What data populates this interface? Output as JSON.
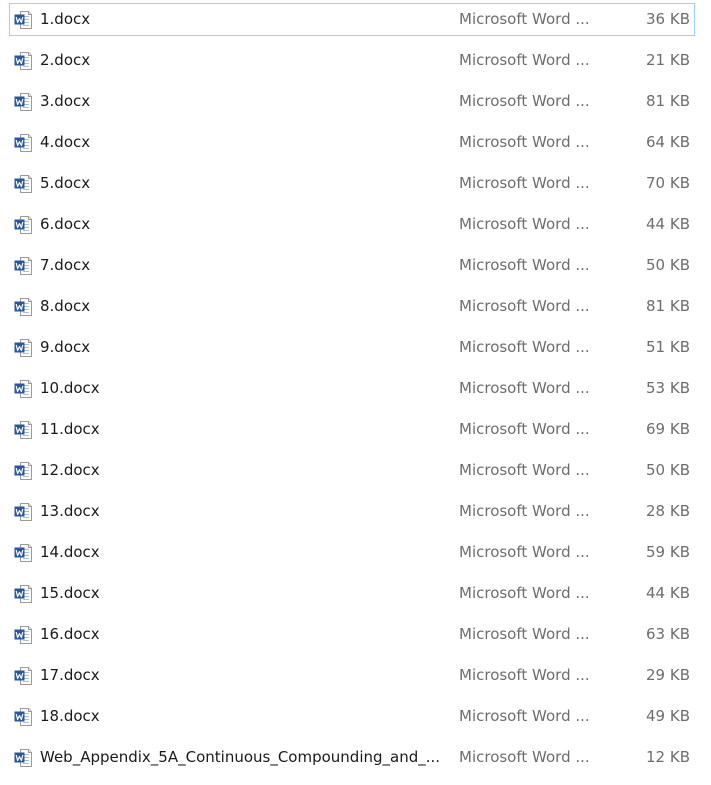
{
  "files": [
    {
      "name": "1.docx",
      "type": "Microsoft Word ...",
      "size": "36 KB",
      "icon": "word-document-icon"
    },
    {
      "name": "2.docx",
      "type": "Microsoft Word ...",
      "size": "21 KB",
      "icon": "word-document-icon"
    },
    {
      "name": "3.docx",
      "type": "Microsoft Word ...",
      "size": "81 KB",
      "icon": "word-document-icon"
    },
    {
      "name": "4.docx",
      "type": "Microsoft Word ...",
      "size": "64 KB",
      "icon": "word-document-icon"
    },
    {
      "name": "5.docx",
      "type": "Microsoft Word ...",
      "size": "70 KB",
      "icon": "word-document-icon"
    },
    {
      "name": "6.docx",
      "type": "Microsoft Word ...",
      "size": "44 KB",
      "icon": "word-document-icon"
    },
    {
      "name": "7.docx",
      "type": "Microsoft Word ...",
      "size": "50 KB",
      "icon": "word-document-icon"
    },
    {
      "name": "8.docx",
      "type": "Microsoft Word ...",
      "size": "81 KB",
      "icon": "word-document-icon"
    },
    {
      "name": "9.docx",
      "type": "Microsoft Word ...",
      "size": "51 KB",
      "icon": "word-document-icon"
    },
    {
      "name": "10.docx",
      "type": "Microsoft Word ...",
      "size": "53 KB",
      "icon": "word-document-icon"
    },
    {
      "name": "11.docx",
      "type": "Microsoft Word ...",
      "size": "69 KB",
      "icon": "word-document-icon"
    },
    {
      "name": "12.docx",
      "type": "Microsoft Word ...",
      "size": "50 KB",
      "icon": "word-document-icon"
    },
    {
      "name": "13.docx",
      "type": "Microsoft Word ...",
      "size": "28 KB",
      "icon": "word-document-icon"
    },
    {
      "name": "14.docx",
      "type": "Microsoft Word ...",
      "size": "59 KB",
      "icon": "word-document-icon"
    },
    {
      "name": "15.docx",
      "type": "Microsoft Word ...",
      "size": "44 KB",
      "icon": "word-document-icon"
    },
    {
      "name": "16.docx",
      "type": "Microsoft Word ...",
      "size": "63 KB",
      "icon": "word-document-icon"
    },
    {
      "name": "17.docx",
      "type": "Microsoft Word ...",
      "size": "29 KB",
      "icon": "word-document-icon"
    },
    {
      "name": "18.docx",
      "type": "Microsoft Word ...",
      "size": "49 KB",
      "icon": "word-document-icon"
    },
    {
      "name": "Web_Appendix_5A_Continuous_Compounding_and_...",
      "type": "Microsoft Word ...",
      "size": "12 KB",
      "icon": "word-document-icon"
    }
  ],
  "focused_index": 0,
  "colors": {
    "word_blue": "#2b579a",
    "focus_border": "#99d1ff",
    "name_text": "#1a1a1a",
    "meta_text": "#6d6d6d"
  }
}
